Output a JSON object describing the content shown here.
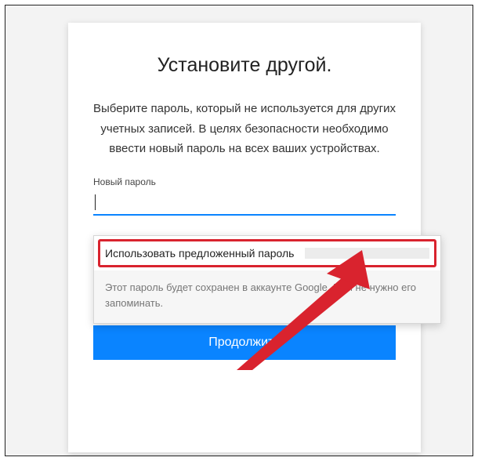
{
  "dialog": {
    "title": "Установите другой.",
    "description": "Выберите пароль, который не используется для других учетных записей. В целях безопасности необходимо ввести новый пароль на всех ваших устройствах.",
    "field_label": "Новый пароль",
    "continue_label": "Продолжить"
  },
  "popup": {
    "suggest_label": "Использовать предложенный пароль",
    "info_text": "Этот пароль будет сохранен в аккаунте Google. Вам не нужно его запоминать."
  },
  "colors": {
    "accent": "#0a84ff",
    "annotation": "#d9232e"
  }
}
